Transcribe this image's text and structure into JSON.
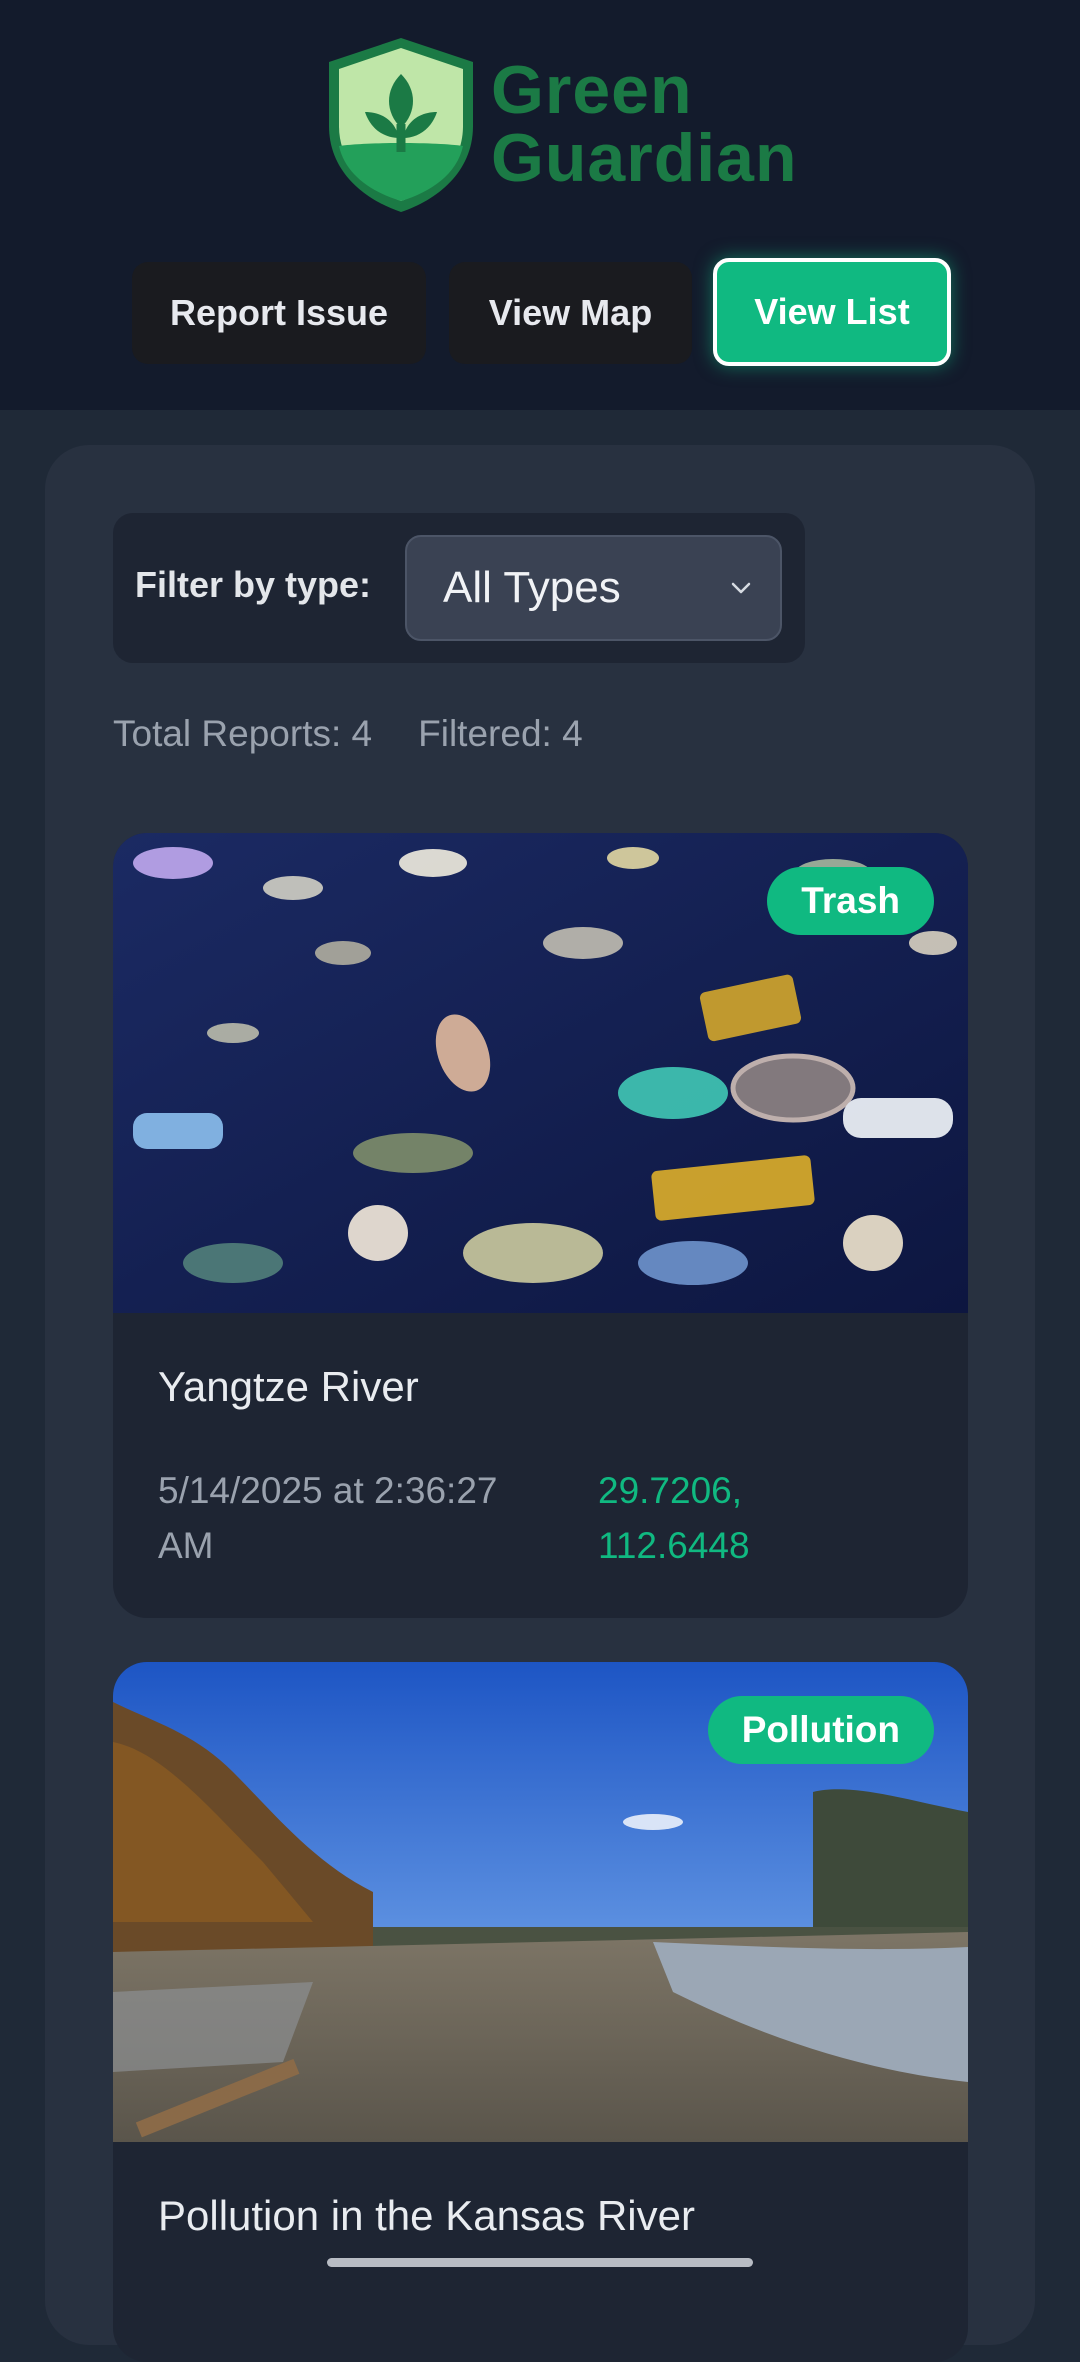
{
  "app": {
    "logo_line1": "Green",
    "logo_line2": "Guardian",
    "brand_color": "#1b7a45",
    "accent_color": "#10b981"
  },
  "nav": {
    "report_label": "Report Issue",
    "map_label": "View Map",
    "list_label": "View List",
    "active": "View List"
  },
  "filter": {
    "label": "Filter by type:",
    "selected": "All Types"
  },
  "stats": {
    "total": "Total Reports: 4",
    "filtered": "Filtered: 4"
  },
  "reports": [
    {
      "badge": "Trash",
      "title": "Yangtze River",
      "date": "5/14/2025 at 2:36:27 AM",
      "coords": "29.7206, 112.6448",
      "image": "river-trash-photo"
    },
    {
      "badge": "Pollution",
      "title": "Pollution in the Kansas River",
      "image": "riverbank-pollution-photo"
    }
  ]
}
